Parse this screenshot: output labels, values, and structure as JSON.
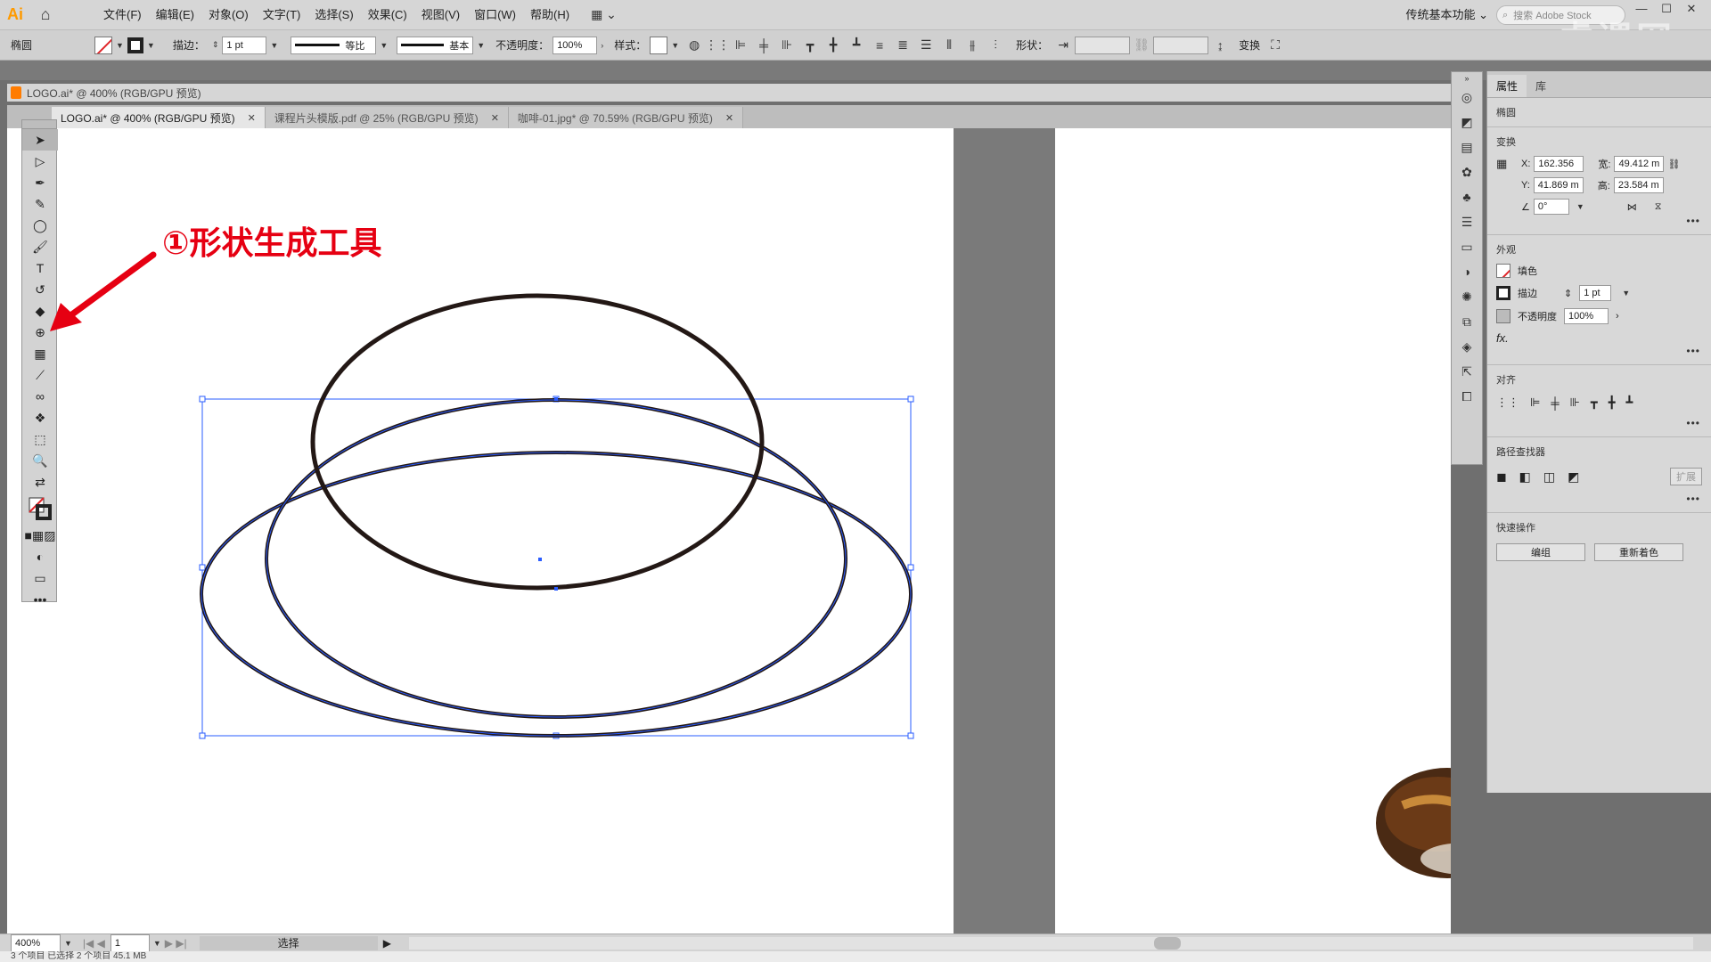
{
  "app": {
    "logo": "Ai",
    "menus": [
      "文件(F)",
      "编辑(E)",
      "对象(O)",
      "文字(T)",
      "选择(S)",
      "效果(C)",
      "视图(V)",
      "窗口(W)",
      "帮助(H)"
    ],
    "workspace": "传统基本功能",
    "search_placeholder": "搜索 Adobe Stock"
  },
  "control_bar": {
    "object_type": "椭圆",
    "stroke_label": "描边：",
    "stroke_weight": "1 pt",
    "profile_label": "等比",
    "brush_label": "基本",
    "opacity_label": "不透明度：",
    "opacity_value": "100%",
    "style_label": "样式：",
    "shape_label": "形状：",
    "transform_label": "变换"
  },
  "document": {
    "title": "LOGO.ai* @ 400% (RGB/GPU 预览)",
    "tabs": [
      {
        "label": "LOGO.ai* @ 400% (RGB/GPU 预览)",
        "active": true
      },
      {
        "label": "课程片头模版.pdf @ 25% (RGB/GPU 预览)",
        "active": false
      },
      {
        "label": "咖啡-01.jpg* @ 70.59% (RGB/GPU 预览)",
        "active": false
      }
    ]
  },
  "annotation": {
    "text": "①形状生成工具",
    "color": "#e60012"
  },
  "properties": {
    "tabs": [
      "属性",
      "库"
    ],
    "object_type": "椭圆",
    "transform_title": "变换",
    "x_label": "X:",
    "x_value": "162.356",
    "y_label": "Y:",
    "y_value": "41.869 m",
    "w_label": "宽:",
    "w_value": "49.412 m",
    "h_label": "高:",
    "h_value": "23.584 m",
    "angle_value": "0°",
    "appearance_title": "外观",
    "fill_label": "填色",
    "stroke_label": "描边",
    "stroke_value": "1 pt",
    "opacity_label": "不透明度",
    "opacity_value": "100%",
    "fx_label": "fx.",
    "align_title": "对齐",
    "pathfinder_title": "路径查找器",
    "pathfinder_expand": "扩展",
    "quick_actions_title": "快速操作",
    "btn_ungroup": "编组",
    "btn_recolor": "重新着色"
  },
  "status_bar": {
    "zoom": "400%",
    "artboard_num": "1",
    "tool_name": "选择"
  },
  "bottom_strip": "3 个项目    已选择 2 个项目    45.1 MB",
  "watermark": "虎课网",
  "colors": {
    "accent_red": "#e60012",
    "selection_blue": "#2a5cff",
    "ellipse_stroke": "#231815"
  }
}
